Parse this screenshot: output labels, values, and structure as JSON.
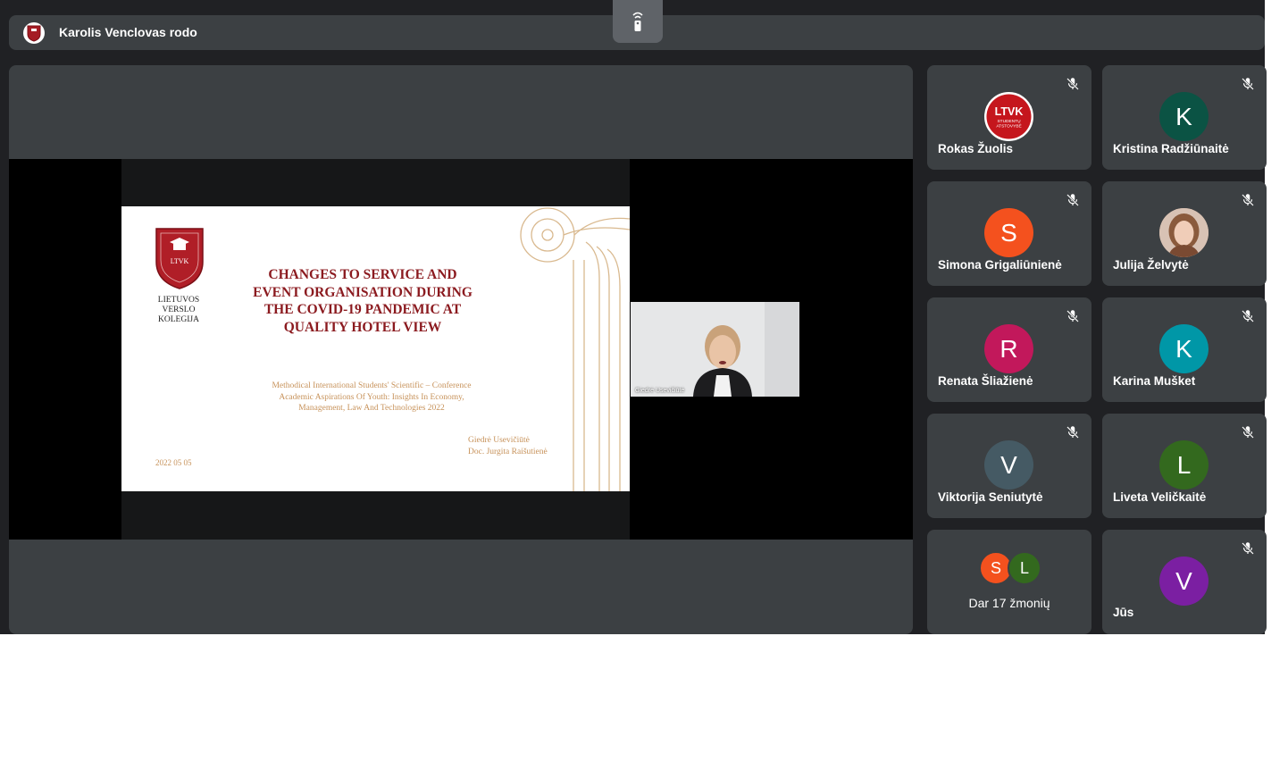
{
  "presenter": {
    "text": "Karolis Venclovas rodo"
  },
  "slide": {
    "logo_text": "LTVK",
    "college_lines": [
      "LIETUVOS",
      "VERSLO",
      "KOLEGIJA"
    ],
    "title_lines": [
      "CHANGES TO SERVICE AND",
      "EVENT ORGANISATION DURING",
      "THE COVID-19 PANDEMIC AT",
      "QUALITY HOTEL VIEW"
    ],
    "conference_lines": [
      "Methodical International Students' Scientific – Conference",
      "Academic Aspirations Of Youth: Insights In Economy,",
      "Management, Law And Technologies 2022"
    ],
    "authors": [
      "Giedrė Usevičiūtė",
      "Doc. Jurgita Raišutienė"
    ],
    "date": "2022 05 05"
  },
  "camera": {
    "name": "Giedrė Usevičiūtė"
  },
  "participants": [
    {
      "name": "Rokas Žuolis",
      "initial": "",
      "color": "#ffffff",
      "logo": "LTVK",
      "logo_sub": [
        "STUDENTŲ",
        "ATSTOVYBĖ"
      ],
      "muted": true
    },
    {
      "name": "Kristina Radžiūnaitė",
      "initial": "K",
      "color": "#0b5344",
      "muted": true
    },
    {
      "name": "Simona Grigaliūnienė",
      "initial": "S",
      "color": "#f4511e",
      "muted": true
    },
    {
      "name": "Julija Želvytė",
      "initial": "",
      "color": "#c9a08a",
      "photo": true,
      "muted": true
    },
    {
      "name": "Renata Šliažienė",
      "initial": "R",
      "color": "#c2185b",
      "muted": true
    },
    {
      "name": "Karina Mušket",
      "initial": "K",
      "color": "#0097a7",
      "muted": true
    },
    {
      "name": "Viktorija Seniutytė",
      "initial": "V",
      "color": "#455a64",
      "muted": true
    },
    {
      "name": "Liveta Veličkaitė",
      "initial": "L",
      "color": "#33691e",
      "muted": true
    }
  ],
  "more": {
    "label": "Dar 17 žmonių",
    "initials": [
      {
        "initial": "S",
        "color": "#f4511e"
      },
      {
        "initial": "L",
        "color": "#33691e"
      }
    ]
  },
  "self_tile": {
    "name": "Jūs",
    "initial": "V",
    "color": "#7b1fa2",
    "muted": true
  }
}
